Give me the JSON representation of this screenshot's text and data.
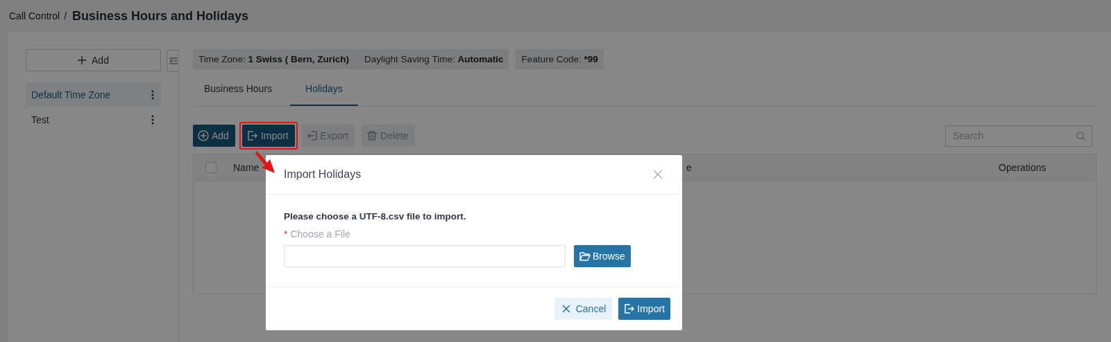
{
  "breadcrumb": {
    "parent": "Call Control",
    "separator": "/",
    "title": "Business Hours and Holidays"
  },
  "sidebar": {
    "add_button": "Add",
    "items": [
      {
        "label": "Default Time Zone",
        "selected": true
      },
      {
        "label": "Test",
        "selected": false
      }
    ]
  },
  "info_tags": [
    {
      "items": [
        {
          "label": "Time Zone:",
          "value": "1 Swiss ( Bern, Zurich)"
        },
        {
          "label": "Daylight Saving Time:",
          "value": "Automatic"
        }
      ]
    },
    {
      "items": [
        {
          "label": "Feature Code:",
          "value": "*99"
        }
      ]
    }
  ],
  "tabs": [
    {
      "label": "Business Hours",
      "selected": false
    },
    {
      "label": "Holidays",
      "selected": true
    }
  ],
  "toolbar": [
    {
      "kind": "add",
      "label": "Add",
      "disabled": false,
      "highlighted": false
    },
    {
      "kind": "import",
      "label": "Import",
      "disabled": false,
      "highlighted": true
    },
    {
      "kind": "export",
      "label": "Export",
      "disabled": true,
      "highlighted": false
    },
    {
      "kind": "delete",
      "label": "Delete",
      "disabled": true,
      "highlighted": false
    }
  ],
  "search": {
    "placeholder": "Search"
  },
  "table": {
    "select_all_checked": false,
    "columns": [
      "Name",
      "e",
      "Operations"
    ]
  },
  "dialog": {
    "title": "Import Holidays",
    "prompt": "Please choose a UTF-8.csv file to import.",
    "field_label": "Choose a File",
    "required_mark": "*",
    "browse_button": "Browse",
    "buttons": [
      {
        "kind": "cancel",
        "label": "Cancel"
      },
      {
        "kind": "import",
        "label": "Import"
      }
    ]
  }
}
